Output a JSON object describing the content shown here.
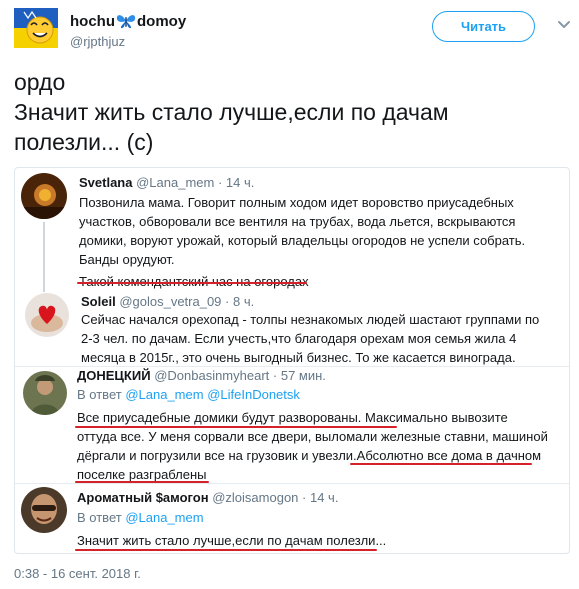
{
  "header": {
    "name_part1": "hochu",
    "name_part2": "domoy",
    "handle": "@rjpthjuz",
    "follow_label": "Читать"
  },
  "tweet": {
    "lines": [
      "ордо",
      "Значит жить стало лучше,если по дачам",
      "полезли... (с)"
    ]
  },
  "embedded": [
    {
      "name": "Svetlana",
      "handle": "@Lana_mem",
      "time": "14 ч.",
      "lines": [
        "Позвонила мама. Говорит полным ходом идет воровство приусадебных",
        "участков, обворовали все вентиля на трубах, вода льется, вскрываются",
        "домики, воруют урожай, который владельцы огородов не успели собрать.",
        "Банды орудуют.",
        "Такой комендантский час на огородах"
      ]
    },
    {
      "name": "Soleil",
      "handle": "@golos_vetra_09",
      "time": "8 ч.",
      "lines": [
        "Сейчас начался орехопад - толпы незнакомых людей шастают группами по",
        "2-3 чел. по дачам.  Если учесть,что благодаря орехам моя семья жила 4",
        "месяца в 2015г., это очень выгодный бизнес. То же касается винограда."
      ]
    },
    {
      "name": "ДОНЕЦКИЙ",
      "handle": "@Donbasinmyheart",
      "time": "57 мин.",
      "reply_prefix": "В ответ",
      "reply_to": [
        "@Lana_mem",
        "@LifeInDonetsk"
      ],
      "lines": [
        "Все приусадебные домики будут разворованы. Максимально вывозите",
        "оттуда все. У меня сорвали все двери, выломали железные ставни, машиной",
        "дёргали и погрузили все на грузовик и увезли.Абсолютно все дома в дачном",
        "поселке разграблены"
      ]
    },
    {
      "name": "Ароматный $амогон",
      "handle": "@zloisamogon",
      "time": "14 ч.",
      "reply_prefix": "В ответ",
      "reply_to": [
        "@Lana_mem"
      ],
      "lines": [
        "Значит жить стало лучше,если по дачам полезли..."
      ]
    }
  ],
  "footer": {
    "timestamp": "0:38 - 16 сент. 2018 г."
  },
  "colors": {
    "accent": "#1da1f2",
    "underline": "#d5222a",
    "muted": "#657786",
    "text": "#14171a"
  },
  "icons": [
    "ukraine-flag-avatar",
    "butterfly-icon",
    "chevron-down-icon"
  ]
}
